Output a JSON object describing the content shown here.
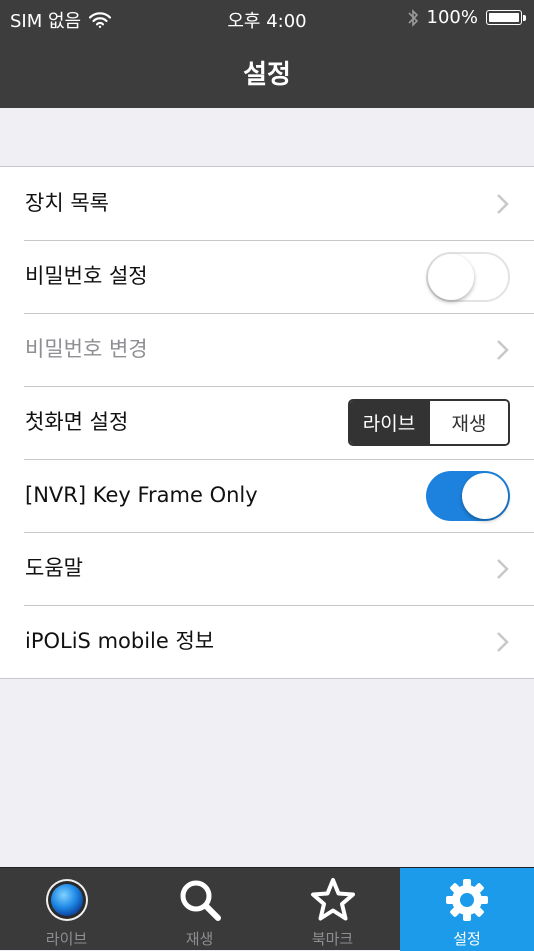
{
  "status_bar": {
    "carrier": "SIM 없음",
    "time": "오후 4:00",
    "battery": "100%"
  },
  "nav": {
    "title": "설정"
  },
  "settings": {
    "device_list": "장치 목록",
    "password_setting": "비밀번호 설정",
    "password_change": "비밀번호 변경",
    "start_screen": "첫화면 설정",
    "start_screen_options": [
      "라이브",
      "재생"
    ],
    "start_screen_selected": "라이브",
    "key_frame_only": "[NVR] Key Frame Only",
    "help": "도움말",
    "about": "iPOLiS mobile 정보",
    "password_toggle_on": false,
    "key_frame_toggle_on": true
  },
  "tabs": [
    {
      "label": "라이브",
      "icon": "live-icon"
    },
    {
      "label": "재생",
      "icon": "search-icon"
    },
    {
      "label": "북마크",
      "icon": "star-icon"
    },
    {
      "label": "설정",
      "icon": "gear-icon"
    }
  ],
  "active_tab": "설정",
  "colors": {
    "header_bg": "#3d3d3d",
    "accent": "#1d82dd",
    "active_tab_bg": "#1c9bea",
    "page_bg": "#efeff4"
  }
}
